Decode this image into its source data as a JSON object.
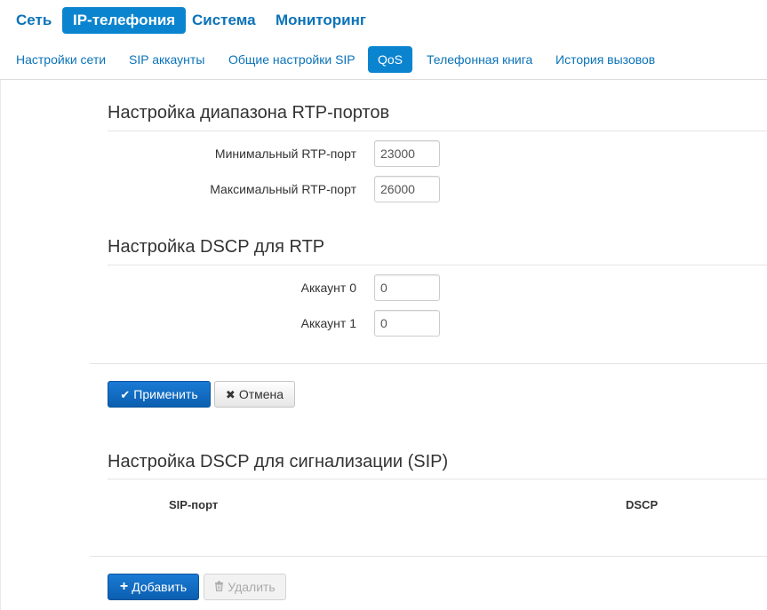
{
  "topnav": {
    "items": [
      {
        "label": "Сеть",
        "active": false
      },
      {
        "label": "IP-телефония",
        "active": true
      },
      {
        "label": "Система",
        "active": false
      },
      {
        "label": "Мониторинг",
        "active": false
      }
    ]
  },
  "subnav": {
    "items": [
      {
        "label": "Настройки сети",
        "active": false
      },
      {
        "label": "SIP аккаунты",
        "active": false
      },
      {
        "label": "Общие настройки SIP",
        "active": false
      },
      {
        "label": "QoS",
        "active": true
      },
      {
        "label": "Телефонная книга",
        "active": false
      },
      {
        "label": "История вызовов",
        "active": false
      }
    ]
  },
  "rtp_ports": {
    "title": "Настройка диапазона RTP-портов",
    "min_label": "Минимальный RTP-порт",
    "min_value": "23000",
    "max_label": "Максимальный RTP-порт",
    "max_value": "26000"
  },
  "dscp_rtp": {
    "title": "Настройка DSCP для RTP",
    "account0_label": "Аккаунт 0",
    "account0_value": "0",
    "account1_label": "Аккаунт 1",
    "account1_value": "0"
  },
  "actions": {
    "apply_label": "Применить",
    "cancel_label": "Отмена"
  },
  "dscp_sip": {
    "title": "Настройка DSCP для сигнализации (SIP)",
    "col_sip_port": "SIP-порт",
    "col_dscp": "DSCP",
    "add_label": "Добавить",
    "delete_label": "Удалить"
  },
  "icons": {
    "apply": "check-icon",
    "cancel": "times-icon",
    "add": "plus-icon",
    "delete": "trash-icon"
  },
  "colors": {
    "accent": "#0b84cf",
    "link": "#0b73b8",
    "primary_button": "#0b5fb0"
  }
}
